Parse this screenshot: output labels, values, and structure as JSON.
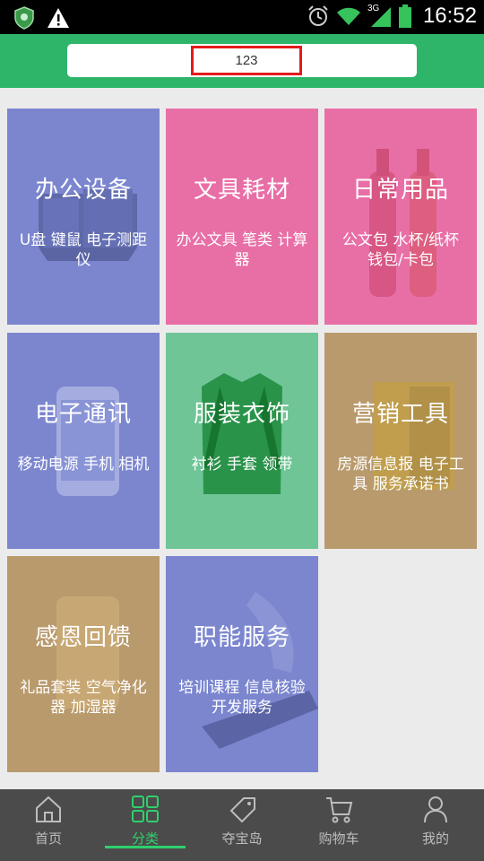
{
  "status_bar": {
    "time": "16:52",
    "left_icons": [
      "shield-icon",
      "warning-icon"
    ],
    "right_icons": [
      "alarm-icon",
      "wifi-icon",
      "signal-3g-icon",
      "battery-icon"
    ],
    "network_label": "3G"
  },
  "search": {
    "value": "123"
  },
  "categories": [
    {
      "title": "办公设备",
      "desc": "U盘 键鼠 电子测距仪",
      "color": "#7b86cf"
    },
    {
      "title": "文具耗材",
      "desc": "办公文具 笔类 计算器",
      "color": "#e86fa6"
    },
    {
      "title": "日常用品",
      "desc": "公文包 水杯/纸杯 钱包/卡包",
      "color": "#e86fa6"
    },
    {
      "title": "电子通讯",
      "desc": "移动电源 手机 相机",
      "color": "#7b86cf"
    },
    {
      "title": "服装衣饰",
      "desc": "衬衫 手套 领带",
      "color": "#6fc596"
    },
    {
      "title": "营销工具",
      "desc": "房源信息报 电子工具 服务承诺书",
      "color": "#b99a6d"
    },
    {
      "title": "感恩回馈",
      "desc": "礼品套装 空气净化器 加湿器",
      "color": "#b99a6d"
    },
    {
      "title": "职能服务",
      "desc": "培训课程 信息核验 开发服务",
      "color": "#7b86cf"
    }
  ],
  "bottom_nav": {
    "items": [
      {
        "label": "首页",
        "icon": "home-icon",
        "active": false
      },
      {
        "label": "分类",
        "icon": "category-grid-icon",
        "active": true
      },
      {
        "label": "夺宝岛",
        "icon": "sale-tag-icon",
        "active": false
      },
      {
        "label": "购物车",
        "icon": "cart-icon",
        "active": false
      },
      {
        "label": "我的",
        "icon": "person-icon",
        "active": false
      }
    ]
  },
  "colors": {
    "brand_green": "#2fb56a",
    "highlight_red": "#e41b1b",
    "nav_active": "#2fd06d",
    "nav_bg": "#4b4b4b"
  }
}
